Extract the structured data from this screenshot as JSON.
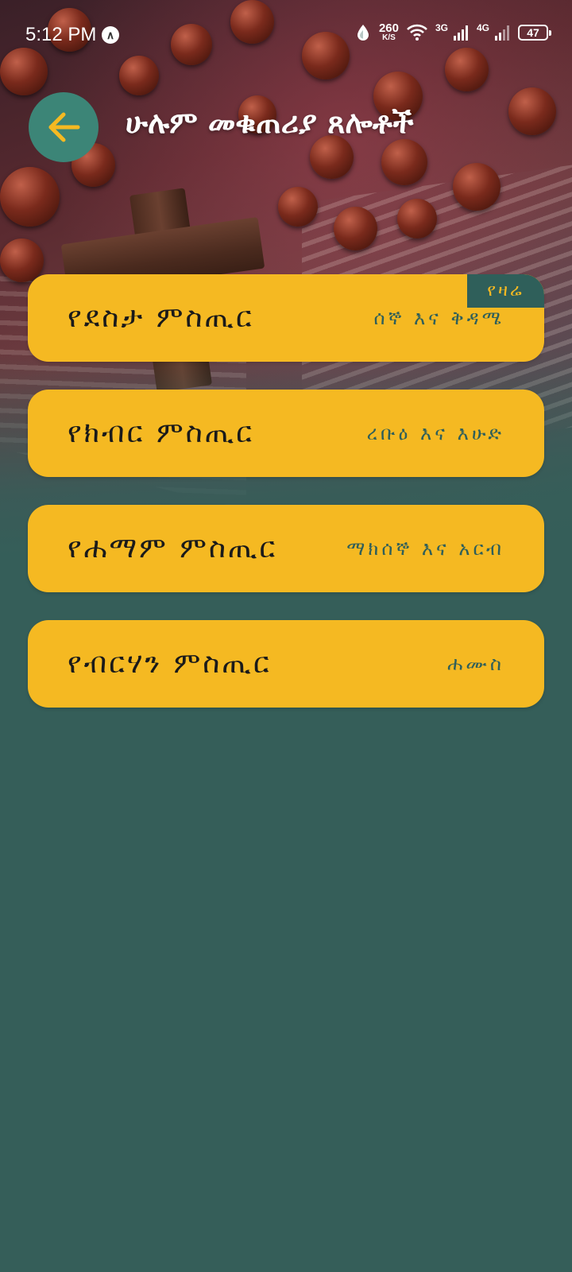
{
  "status_bar": {
    "time": "5:12 PM",
    "net_speed_value": "260",
    "net_speed_unit": "K/S",
    "network_3g": "3G",
    "network_4g": "4G",
    "battery_level": "47"
  },
  "header": {
    "title": "ሁሉም መቁጠሪያ ጸሎቶች"
  },
  "colors": {
    "background": "#355e59",
    "card": "#f5b922",
    "accent_dark": "#2f5f5a",
    "back_button": "#3c8577"
  },
  "mysteries": [
    {
      "title": "የደስታ ምስጢር",
      "days": "ሰኞ እና ቅዳሜ",
      "badge": "የዛሬ"
    },
    {
      "title": "የክብር ምስጢር",
      "days": "ረቡዕ እና እሁድ"
    },
    {
      "title": "የሐማም ምስጢር",
      "days": "ማክሰኞ እና አርብ"
    },
    {
      "title": "የብርሃን ምስጢር",
      "days": "ሐሙስ"
    }
  ]
}
